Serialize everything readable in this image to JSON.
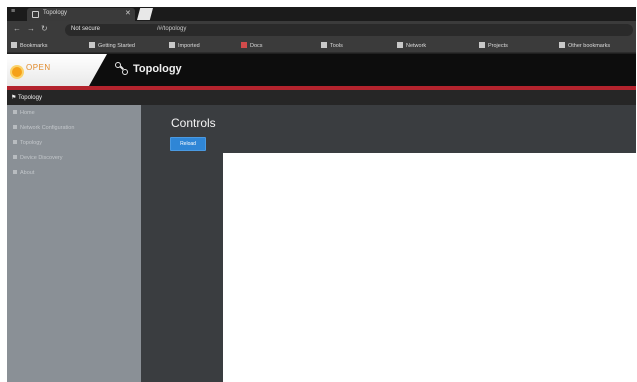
{
  "browser": {
    "tab_title": "Topology",
    "omnibox_security": "Not secure",
    "omnibox_url": "/#/topology",
    "bookmarks": [
      "Bookmarks",
      "Getting Started",
      "Imported",
      "Docs",
      "Tools",
      "Network",
      "Projects",
      "Other bookmarks"
    ]
  },
  "app": {
    "logo_text": "OPEN",
    "logo_sub": "",
    "title": "Topology",
    "sidebar_header": "Topology",
    "sidebar_items": [
      "Home",
      "Network Configuration",
      "Topology",
      "Device Discovery",
      "About"
    ],
    "main_title": "Controls",
    "primary_button": "Reload"
  }
}
